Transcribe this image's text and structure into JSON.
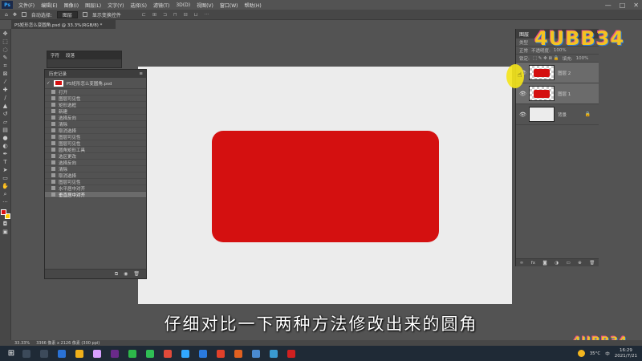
{
  "menubar": {
    "app_logo": "Ps",
    "items": [
      "文件(F)",
      "编辑(E)",
      "图像(I)",
      "图层(L)",
      "文字(Y)",
      "选择(S)",
      "滤镜(T)",
      "3D(D)",
      "视图(V)",
      "窗口(W)",
      "帮助(H)"
    ],
    "window_controls": [
      "—",
      "□",
      "✕"
    ]
  },
  "options": {
    "auto_select_label": "自动选择:",
    "auto_select_value": "图层",
    "show_transform_label": "显示变换控件"
  },
  "document": {
    "tab_title": "PS矩形怎么变圆角.psd @ 33.3%(RGB/8) *"
  },
  "panels": {
    "small_tabs": [
      "字符",
      "段落"
    ],
    "history": {
      "title": "历史记录",
      "snapshot": "PS矩形怎么变圆角.psd",
      "items": [
        "打开",
        "图层可见性",
        "矩形选框",
        "新建",
        "选择反向",
        "清除",
        "取消选择",
        "图层可见性",
        "图层可见性",
        "圆角矩形工具",
        "选区更改",
        "选择反向",
        "清除",
        "取消选择",
        "图层可见性",
        "水平居中对齐",
        "垂直居中对齐"
      ]
    }
  },
  "layers": {
    "tab": "图层",
    "row_kind": "类型",
    "row_blend": "正常",
    "row_opacity_label": "不透明度:",
    "row_opacity": "100%",
    "row_lock_label": "锁定:",
    "row_fill_label": "填充:",
    "row_fill": "100%",
    "items": [
      {
        "name": "图层 2"
      },
      {
        "name": "图层 1"
      },
      {
        "name": "背景"
      }
    ]
  },
  "watermark": {
    "text": "4UBB34"
  },
  "subtitle": "仔细对比一下两种方法修改出来的圆角",
  "status": {
    "zoom": "33.33%",
    "doc_size": "3366 像素 x 2126 像素 (300 ppi)"
  },
  "taskbar": {
    "weather": "35°C",
    "tray_text": "中",
    "date": "2021/7/21",
    "time": "16:29"
  },
  "colors": {
    "shape_red": "#d41010",
    "ps_bg": "#535353",
    "canvas": "#ececec",
    "watermark_yellow": "#f3c322"
  }
}
